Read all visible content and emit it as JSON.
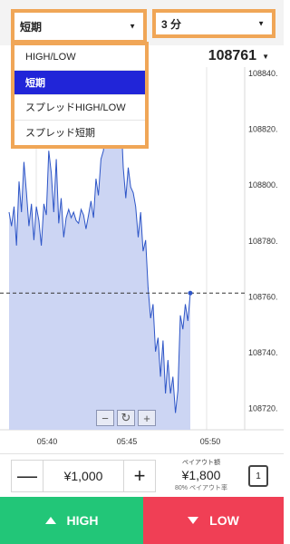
{
  "selects": {
    "type": {
      "value": "短期"
    },
    "duration": {
      "value": "3 分"
    }
  },
  "dropdown": {
    "items": [
      {
        "label": "HIGH/LOW",
        "selected": false
      },
      {
        "label": "短期",
        "selected": true
      },
      {
        "label": "スプレッドHIGH/LOW",
        "selected": false
      },
      {
        "label": "スプレッド短期",
        "selected": false
      }
    ]
  },
  "price_readout": "108761",
  "chart_data": {
    "type": "area",
    "y_ticks": [
      "108840.",
      "108820.",
      "108800.",
      "108780.",
      "108760.",
      "108740.",
      "108720."
    ],
    "x_ticks": [
      "05:40",
      "05:45",
      "05:50"
    ],
    "ylim": [
      108712,
      108842
    ],
    "current_value": 108761,
    "series": [
      {
        "values": [
          108790,
          108785,
          108792,
          108778,
          108801,
          108790,
          108808,
          108797,
          108785,
          108793,
          108780,
          108792,
          108787,
          108778,
          108793,
          108789,
          108812,
          108804,
          108790,
          108809,
          108786,
          108795,
          108781,
          108788,
          108791,
          108788,
          108790,
          108787,
          108786,
          108791,
          108789,
          108784,
          108789,
          108794,
          108788,
          108802,
          108796,
          108809,
          108812,
          108822,
          108836,
          108832,
          108828,
          108831,
          108818,
          108826,
          108806,
          108795,
          108806,
          108799,
          108797,
          108792,
          108781,
          108790,
          108776,
          108780,
          108763,
          108752,
          108757,
          108740,
          108745,
          108731,
          108744,
          108725,
          108737,
          108725,
          108731,
          108718,
          108726,
          108753,
          108748,
          108757,
          108751,
          108761
        ]
      }
    ]
  },
  "controls": {
    "zoom_out": "−",
    "reset": "↻",
    "zoom_in": "+"
  },
  "trade": {
    "minus": "—",
    "amount": "¥1,000",
    "plus": "+",
    "payout_label": "ペイアウト額",
    "payout_value": "¥1,800",
    "payout_rate": "80% ペイアウト率",
    "count": "1"
  },
  "buttons": {
    "high": "HIGH",
    "low": "LOW"
  },
  "colors": {
    "high": "#22c678",
    "low": "#f03f55",
    "selected": "#2125d8",
    "accent": "#f0a657",
    "chart_fill": "#ccd5f3",
    "chart_line": "#2d55c7"
  }
}
